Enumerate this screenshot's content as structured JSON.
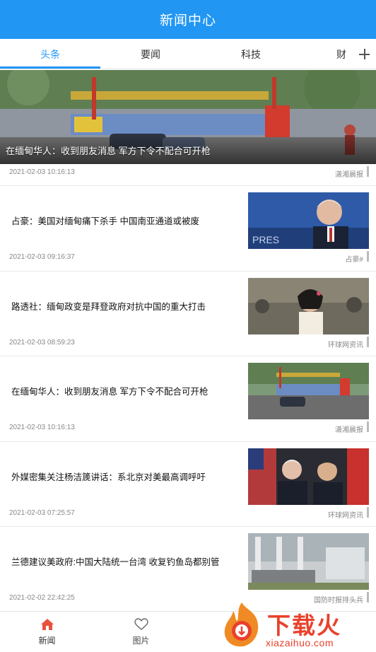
{
  "header": {
    "title": "新闻中心"
  },
  "tabs": {
    "items": [
      {
        "label": "头条",
        "active": true
      },
      {
        "label": "要闻",
        "active": false
      },
      {
        "label": "科技",
        "active": false
      }
    ],
    "clipped_label": "财",
    "accent_color": "#2196f3"
  },
  "hero": {
    "caption": "在缅甸华人：收到朋友消息 军方下令不配合可开枪",
    "time": "2021-02-03 10:16:13",
    "source": "潇湘晨报"
  },
  "news": [
    {
      "headline": "占豪：美国对缅甸痛下杀手 中国南亚通道或被废",
      "time": "2021-02-03 09:16:37",
      "source": "占豪#"
    },
    {
      "headline": "路透社：缅甸政变是拜登政府对抗中国的重大打击",
      "time": "2021-02-03 08:59:23",
      "source": "环球网资讯"
    },
    {
      "headline": "在缅甸华人：收到朋友消息 军方下令不配合可开枪",
      "time": "2021-02-03 10:16:13",
      "source": "潇湘晨报"
    },
    {
      "headline": "外媒密集关注杨洁篪讲话：系北京对美最高调呼吁",
      "time": "2021-02-03 07:25:57",
      "source": "环球网资讯"
    },
    {
      "headline": "兰德建议美政府:中国大陆统一台湾 收复钓鱼岛都别管",
      "time": "2021-02-02 22:42:25",
      "source": "国防时报排头兵"
    }
  ],
  "bottom_nav": [
    {
      "label": "新闻",
      "icon": "home-icon",
      "active": true
    },
    {
      "label": "图片",
      "icon": "heart-icon",
      "active": false
    }
  ],
  "watermark": {
    "text": "下载火",
    "sub": "xiazaihuo.com"
  }
}
